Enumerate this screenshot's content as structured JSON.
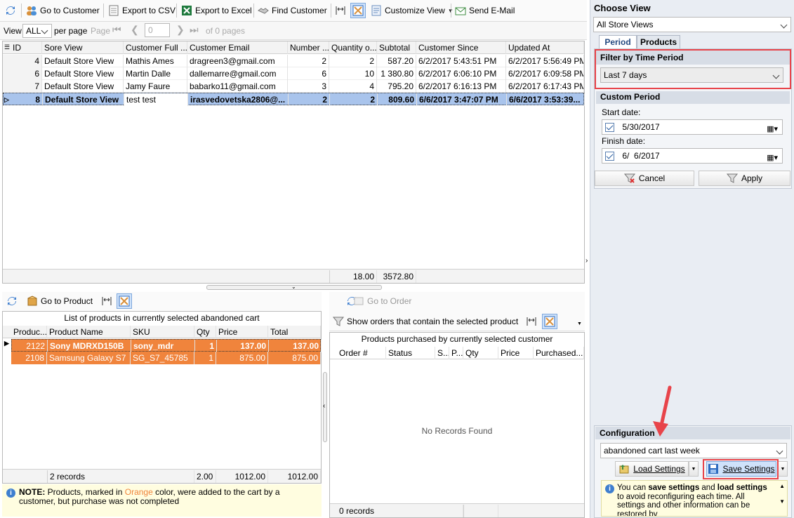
{
  "toolbar": {
    "go_to_customer": "Go to Customer",
    "export_csv": "Export to CSV",
    "export_excel": "Export to Excel",
    "find_customer": "Find Customer",
    "customize_view": "Customize View",
    "send_email": "Send E-Mail"
  },
  "pager": {
    "view_label": "View",
    "view_value": "ALL",
    "per_page": "per page",
    "page_label": "Page",
    "page_value": "0",
    "of_pages": "of 0 pages"
  },
  "customers": {
    "columns": [
      "ID",
      "Sore View",
      "Customer Full ...",
      "Customer Email",
      "Number ...",
      "Quantity o...",
      "Subtotal",
      "Customer Since",
      "Updated At"
    ],
    "rows": [
      {
        "id": "4",
        "store": "Default Store View",
        "name": "Mathis Ames",
        "email": "dragreen3@gmail.com",
        "number": "2",
        "qty": "2",
        "subtotal": "587.20",
        "since": "6/2/2017 5:43:51 PM",
        "updated": "6/2/2017 5:56:49 PM"
      },
      {
        "id": "6",
        "store": "Default Store View",
        "name": "Martin Dalle",
        "email": "dallemarre@gmail.com",
        "number": "6",
        "qty": "10",
        "subtotal": "1 380.80",
        "since": "6/2/2017 6:06:10 PM",
        "updated": "6/2/2017 6:09:58 PM"
      },
      {
        "id": "7",
        "store": "Default Store View",
        "name": "Jamy Faure",
        "email": "babarko11@gmail.com",
        "number": "3",
        "qty": "4",
        "subtotal": "795.20",
        "since": "6/2/2017 6:16:13 PM",
        "updated": "6/2/2017 6:17:43 PM"
      },
      {
        "id": "8",
        "store": "Default Store View",
        "name": "test test",
        "email": "irasvedovetska2806@...",
        "number": "2",
        "qty": "2",
        "subtotal": "809.60",
        "since": "6/6/2017 3:47:07 PM",
        "updated": "6/6/2017 3:53:39..."
      }
    ],
    "footer_qty": "18.00",
    "footer_subtotal": "3572.80"
  },
  "products_panel": {
    "go_to_product": "Go to Product",
    "caption": "List of products in currently selected abandoned cart",
    "columns": [
      "Produc...",
      "Product Name",
      "SKU",
      "Qty",
      "Price",
      "Total"
    ],
    "rows": [
      {
        "id": "2122",
        "name": "Sony MDRXD150B",
        "sku": "sony_mdr",
        "qty": "1",
        "price": "137.00",
        "total": "137.00"
      },
      {
        "id": "2108",
        "name": "Samsung Galaxy S7",
        "sku": "SG_S7_45785",
        "qty": "1",
        "price": "875.00",
        "total": "875.00"
      }
    ],
    "footer_records": "2 records",
    "footer_qty": "2.00",
    "footer_price": "1012.00",
    "footer_total": "1012.00",
    "note_bold": "NOTE:",
    "note_text1": " Products, marked in ",
    "note_orange": "Orange",
    "note_text2": " color, were added to the cart by a customer, but purchase was not completed"
  },
  "orders_panel": {
    "go_to_order": "Go to Order",
    "show_orders": "Show orders that contain the selected product",
    "caption": "Products purchased by currently selected customer",
    "columns": [
      "Order #",
      "Status",
      "S...",
      "P...",
      "Qty",
      "Price",
      "Purchased..."
    ],
    "empty": "No Records Found",
    "footer_records": "0 records"
  },
  "right_panel": {
    "title": "Choose View",
    "store_view": "All Store Views",
    "tabs": [
      "Period",
      "Products"
    ],
    "filter_title": "Filter by Time Period",
    "filter_value": "Last 7 days",
    "custom_title": "Custom Period",
    "start_label": "Start date:",
    "start_value": "5/30/2017",
    "finish_label": "Finish date:",
    "finish_value": "6/  6/2017",
    "cancel": "Cancel",
    "apply": "Apply",
    "config_title": "Configuration",
    "config_value": "abandoned cart last week",
    "load_settings": "Load Settings",
    "save_settings": "Save Settings",
    "info_1": "You can ",
    "info_b1": "save settings",
    "info_2": " and ",
    "info_b2": "load settings",
    "info_3": " to avoid reconfiguring each time. All settings and other information can be restored by"
  },
  "colors": {
    "accent": "#e8444a",
    "orange_rows": "#f0843c",
    "selected_row": "#a9c4ec"
  }
}
